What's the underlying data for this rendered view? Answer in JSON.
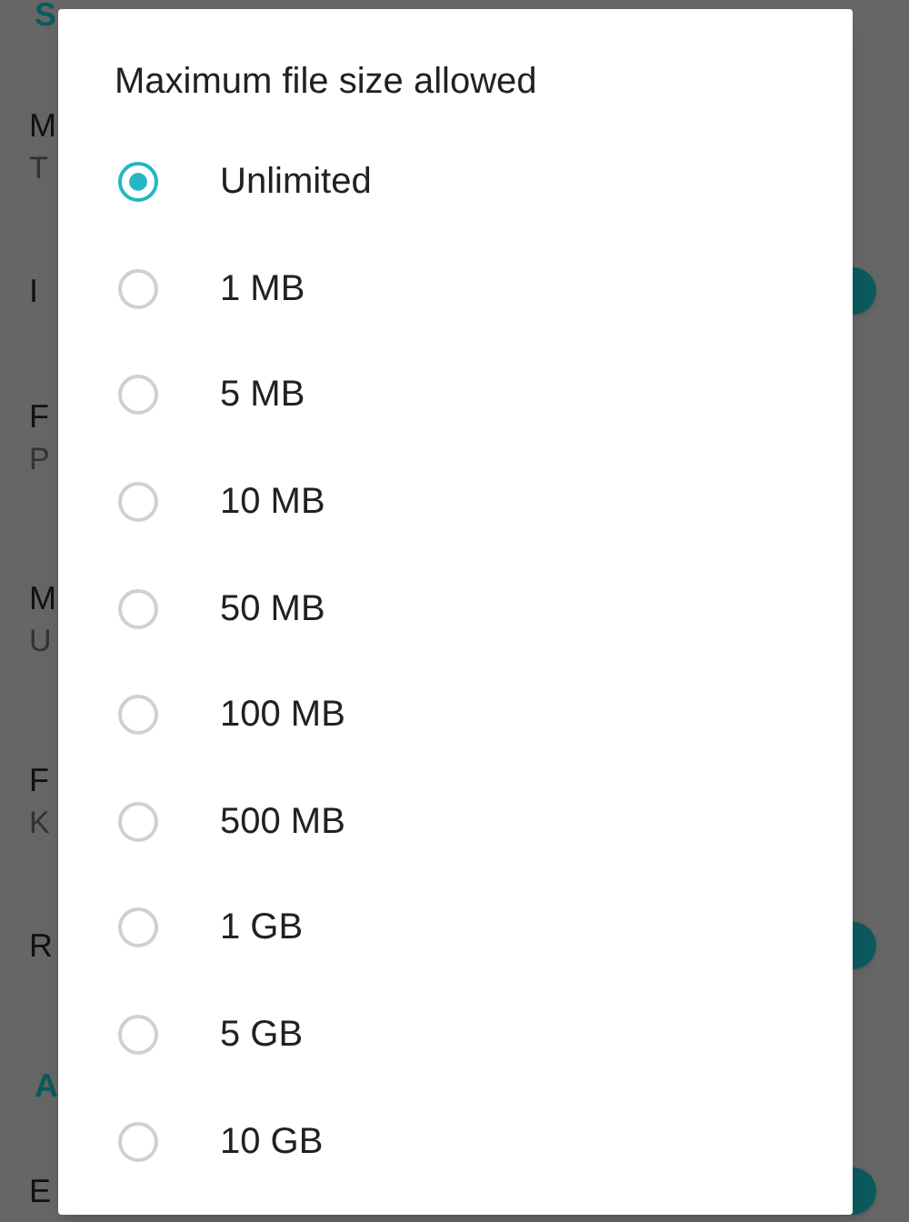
{
  "background_settings": [
    {
      "kind": "header",
      "title": "S"
    },
    {
      "kind": "setting",
      "title": "M",
      "summary": "T"
    },
    {
      "kind": "setting",
      "title": "I",
      "toggle": {
        "on": true
      }
    },
    {
      "kind": "setting",
      "title": "F",
      "summary": "P"
    },
    {
      "kind": "setting",
      "title": "M",
      "summary": "U"
    },
    {
      "kind": "setting",
      "title": "F",
      "summary": "K"
    },
    {
      "kind": "setting",
      "title": "R",
      "toggle": {
        "on": true
      }
    },
    {
      "kind": "header",
      "title": "A"
    },
    {
      "kind": "setting",
      "title": "E",
      "toggle": {
        "on": true
      }
    }
  ],
  "dialog": {
    "title": "Maximum file size allowed",
    "options": [
      {
        "label": "Unlimited",
        "selected": true
      },
      {
        "label": "1 MB",
        "selected": false
      },
      {
        "label": "5 MB",
        "selected": false
      },
      {
        "label": "10 MB",
        "selected": false
      },
      {
        "label": "50 MB",
        "selected": false
      },
      {
        "label": "100 MB",
        "selected": false
      },
      {
        "label": "500 MB",
        "selected": false
      },
      {
        "label": "1 GB",
        "selected": false
      },
      {
        "label": "5 GB",
        "selected": false
      },
      {
        "label": "10 GB",
        "selected": false
      }
    ]
  }
}
